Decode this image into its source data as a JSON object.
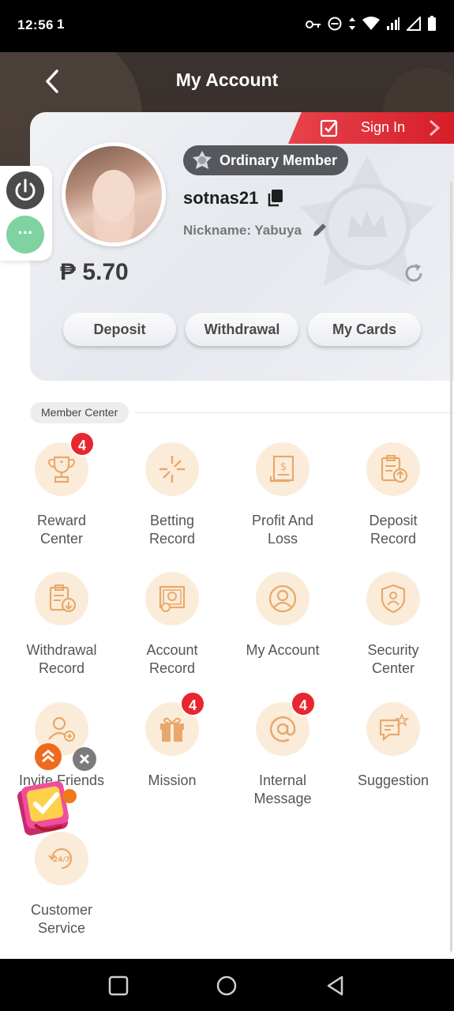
{
  "status_bar": {
    "time": "12:56",
    "left_indicator": "1"
  },
  "header": {
    "title": "My Account"
  },
  "card": {
    "sign_in_label": "Sign In",
    "member_level": "Ordinary Member",
    "username": "sotnas21",
    "nickname": "Nickname: Yabuya",
    "balance": "₱ 5.70",
    "actions": {
      "deposit": "Deposit",
      "withdrawal": "Withdrawal",
      "my_cards": "My Cards"
    }
  },
  "section": {
    "title": "Member Center"
  },
  "items": {
    "reward_center": {
      "label1": "Reward",
      "label2": "Center",
      "badge": "4"
    },
    "betting_record": {
      "label1": "Betting",
      "label2": "Record"
    },
    "profit_and_loss": {
      "label1": "Profit And",
      "label2": "Loss"
    },
    "deposit_record": {
      "label1": "Deposit",
      "label2": "Record"
    },
    "withdrawal_record": {
      "label1": "Withdrawal",
      "label2": "Record"
    },
    "account_record": {
      "label1": "Account",
      "label2": "Record"
    },
    "my_account": {
      "label1": "My Account"
    },
    "security_center": {
      "label1": "Security",
      "label2": "Center"
    },
    "invite_friends": {
      "label1": "Invite Friends"
    },
    "mission": {
      "label1": "Mission",
      "badge": "4"
    },
    "internal_message": {
      "label1": "Internal",
      "label2": "Message",
      "badge": "4"
    },
    "suggestion": {
      "label1": "Suggestion"
    },
    "customer_service": {
      "label1": "Customer",
      "label2": "Service",
      "icon_text": "24/7"
    }
  },
  "side_buttons": {
    "more_label": "···"
  },
  "colors": {
    "accent_red": "#e8262f",
    "icon_bg": "#fbecd9",
    "icon_stroke": "#e8a86b",
    "header_bg": "#3a3330",
    "power_bg": "#4b4b4b",
    "more_bg": "#7fd3a0"
  }
}
